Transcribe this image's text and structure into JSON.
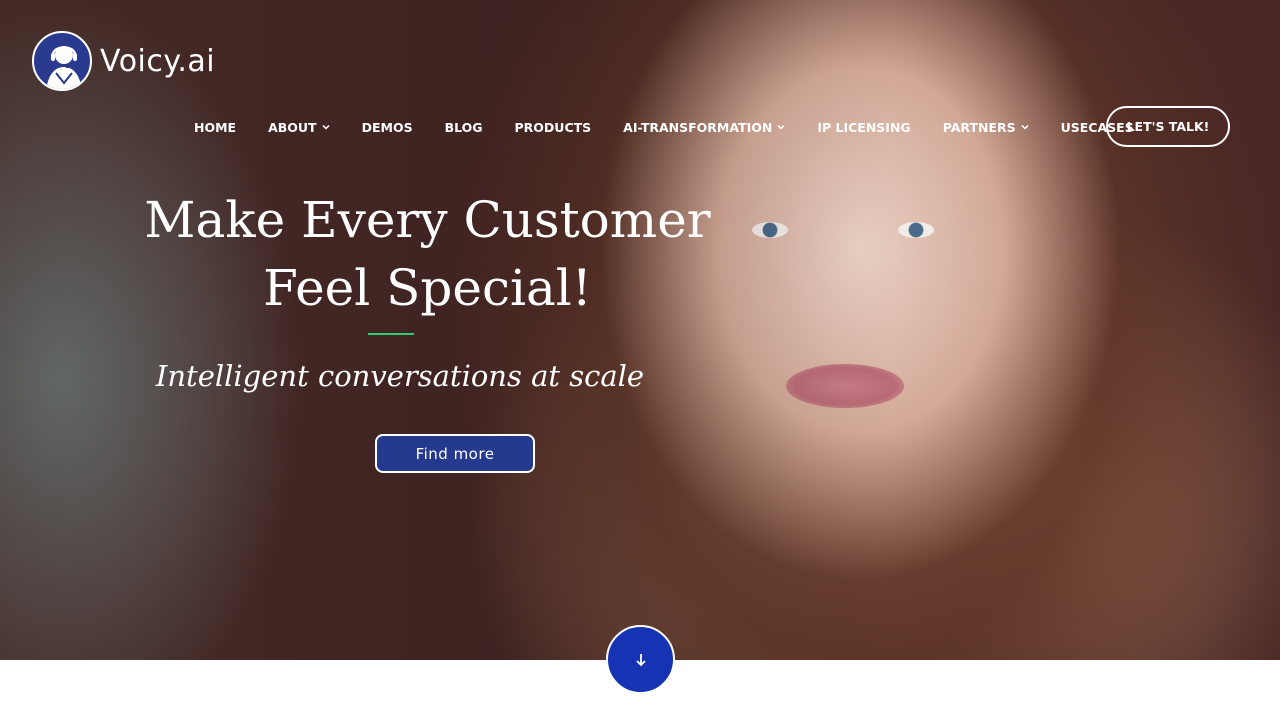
{
  "brand": {
    "name": "Voicy.ai",
    "logo_icon": "headset-agent-icon",
    "color": "#2a3b8f"
  },
  "nav": {
    "items": [
      {
        "label": "HOME",
        "has_dropdown": false
      },
      {
        "label": "ABOUT",
        "has_dropdown": true
      },
      {
        "label": "DEMOS",
        "has_dropdown": false
      },
      {
        "label": "BLOG",
        "has_dropdown": false
      },
      {
        "label": "PRODUCTS",
        "has_dropdown": false
      },
      {
        "label": "AI-TRANSFORMATION",
        "has_dropdown": true
      },
      {
        "label": "IP LICENSING",
        "has_dropdown": false
      },
      {
        "label": "PARTNERS",
        "has_dropdown": true
      },
      {
        "label": "USECASES",
        "has_dropdown": false
      }
    ],
    "cta_label": "LET'S TALK!"
  },
  "hero": {
    "headline_line1": "Make Every Customer",
    "headline_line2": "Feel Special!",
    "accent_color": "#2ecc71",
    "subheadline": "Intelligent conversations at scale",
    "button_label": "Find more",
    "button_color": "#25398f",
    "scroll_icon": "arrow-down-icon",
    "scroll_button_color": "#1633b4"
  }
}
